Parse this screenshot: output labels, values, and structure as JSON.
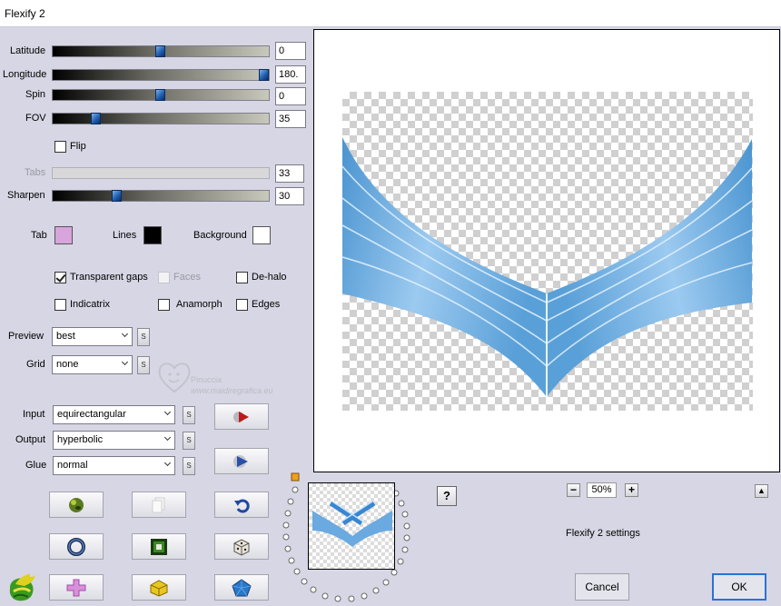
{
  "window": {
    "title": "Flexify 2"
  },
  "sliders": [
    {
      "id": "latitude",
      "label": "Latitude",
      "value": "0",
      "fraction": 0.5,
      "enabled": true
    },
    {
      "id": "longitude",
      "label": "Longitude",
      "value": "180.",
      "fraction": 0.98,
      "enabled": true
    },
    {
      "id": "spin",
      "label": "Spin",
      "value": "0",
      "fraction": 0.5,
      "enabled": true
    },
    {
      "id": "fov",
      "label": "FOV",
      "value": "35",
      "fraction": 0.2,
      "enabled": true
    },
    {
      "id": "tabs",
      "label": "Tabs",
      "value": "33",
      "fraction": 0.0,
      "enabled": false
    },
    {
      "id": "sharpen",
      "label": "Sharpen",
      "value": "30",
      "fraction": 0.3,
      "enabled": true
    }
  ],
  "flip": {
    "label": "Flip",
    "checked": false
  },
  "colors": {
    "tab": {
      "label": "Tab",
      "color": "#d8a4dc"
    },
    "lines": {
      "label": "Lines",
      "color": "#000000"
    },
    "background": {
      "label": "Background",
      "color": "#ffffff"
    }
  },
  "options": {
    "transparent_gaps": {
      "label": "Transparent gaps",
      "checked": true
    },
    "faces": {
      "label": "Faces",
      "checked": false,
      "enabled": false
    },
    "de_halo": {
      "label": "De-halo",
      "checked": false
    },
    "indicatrix": {
      "label": "Indicatrix",
      "checked": false
    },
    "anamorph": {
      "label": "Anamorph",
      "checked": false
    },
    "edges": {
      "label": "Edges",
      "checked": false
    }
  },
  "dropdowns": {
    "preview": {
      "label": "Preview",
      "value": "best"
    },
    "grid": {
      "label": "Grid",
      "value": "none"
    },
    "input": {
      "label": "Input",
      "value": "equirectangular"
    },
    "output": {
      "label": "Output",
      "value": "hyperbolic"
    },
    "glue": {
      "label": "Glue",
      "value": "normal"
    }
  },
  "small_button_label": "S",
  "watermark": {
    "line1": "Pinuccia",
    "line2": "www.maidiregrafica.eu"
  },
  "zoom": {
    "value": "50%",
    "minus": "−",
    "plus": "+"
  },
  "help_label": "?",
  "status": "Flexify 2 settings",
  "buttons": {
    "cancel": "Cancel",
    "ok": "OK"
  },
  "accent_color": "#2a72d6"
}
